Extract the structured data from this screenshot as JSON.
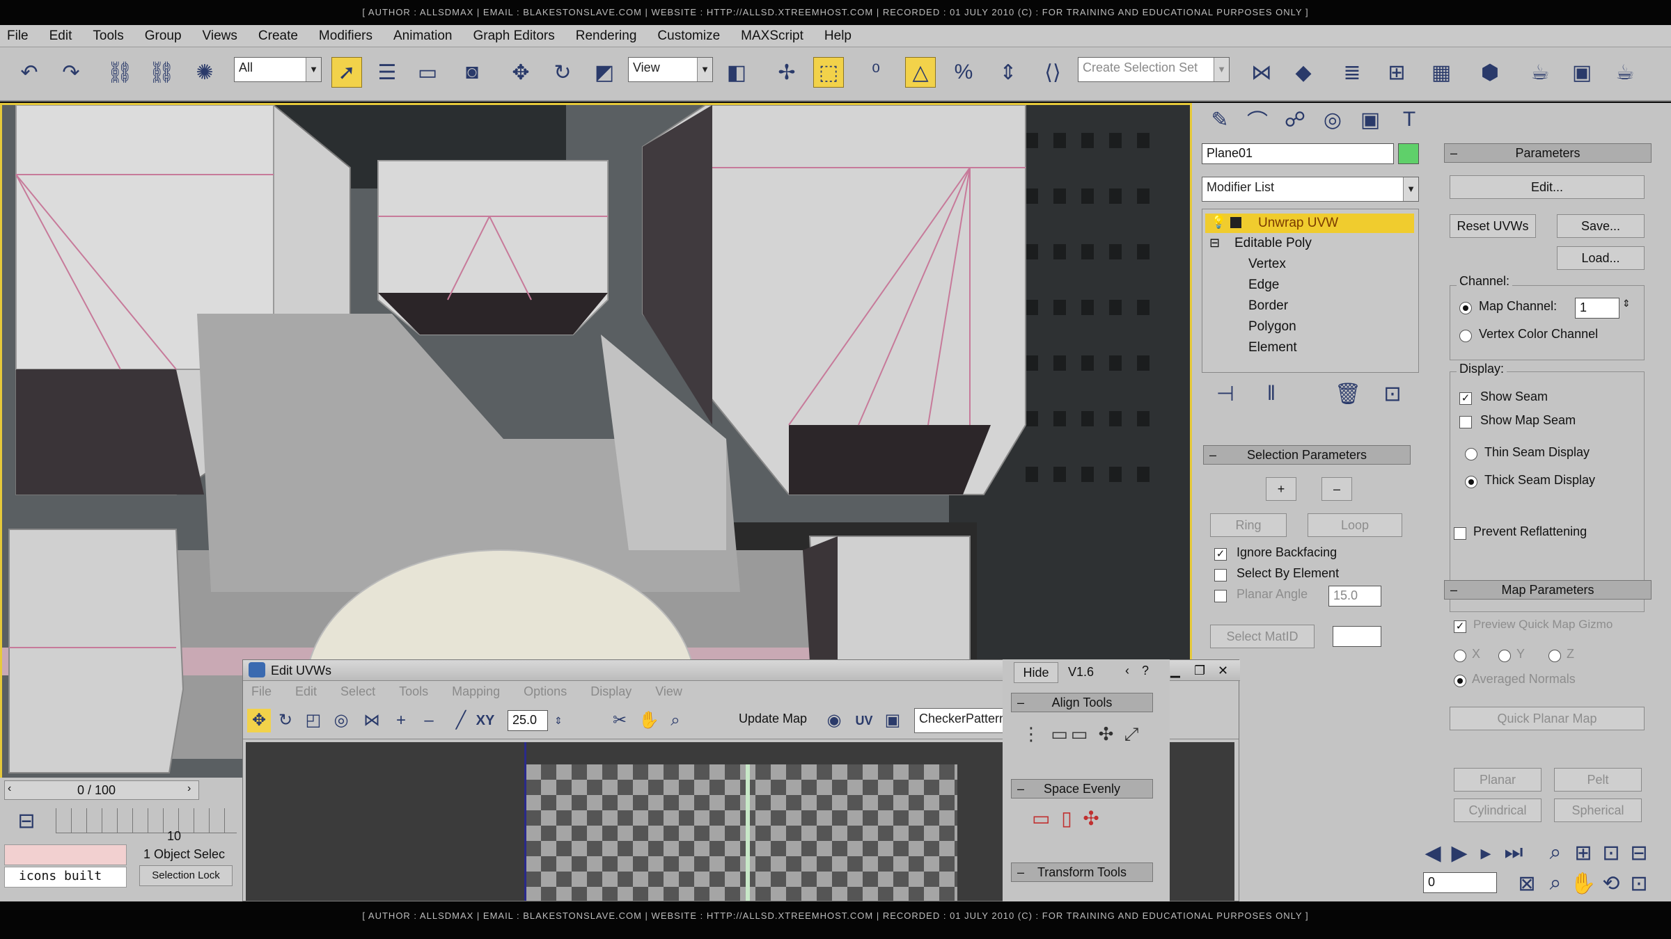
{
  "banner": {
    "text": "[ AUTHOR : ALLSDMAX | EMAIL : BLAKESTONSLAVE.COM | WEBSITE : HTTP://ALLSD.XTREEMHOST.COM | RECORDED : 01 JULY 2010 (C) : FOR TRAINING AND EDUCATIONAL PURPOSES ONLY ]"
  },
  "menu": [
    "File",
    "Edit",
    "Tools",
    "Group",
    "Views",
    "Create",
    "Modifiers",
    "Animation",
    "Graph Editors",
    "Rendering",
    "Customize",
    "MAXScript",
    "Help"
  ],
  "toolbar": {
    "filter_value": "All",
    "refcoord_value": "View",
    "selset_placeholder": "Create Selection Set"
  },
  "panel": {
    "object_name": "Plane01",
    "object_color": "#5fd06a",
    "modifier_list": "Modifier List",
    "stack": [
      {
        "label": "Unwrap UVW",
        "level": 0,
        "selected": true
      },
      {
        "label": "Editable Poly",
        "level": 0,
        "selected": false
      },
      {
        "label": "Vertex",
        "level": 1
      },
      {
        "label": "Edge",
        "level": 1
      },
      {
        "label": "Border",
        "level": 1
      },
      {
        "label": "Polygon",
        "level": 1
      },
      {
        "label": "Element",
        "level": 1
      }
    ],
    "selection_params": {
      "header": "Selection Parameters",
      "ring": "Ring",
      "loop": "Loop",
      "ignore_backfacing": "Ignore Backfacing",
      "select_by_element": "Select By Element",
      "planar_angle": "Planar Angle",
      "planar_value": "15.0",
      "select_matid": "Select MatID",
      "matid_value": ""
    },
    "parameters": {
      "header": "Parameters",
      "edit": "Edit...",
      "reset": "Reset UVWs",
      "save": "Save...",
      "load": "Load...",
      "channel_label": "Channel:",
      "map_channel": "Map Channel:",
      "map_channel_value": "1",
      "vertex_color_channel": "Vertex Color Channel",
      "display_label": "Display:",
      "show_seam": "Show Seam",
      "show_map_seam": "Show Map Seam",
      "thin_seam": "Thin Seam Display",
      "thick_seam": "Thick Seam Display",
      "prevent_reflattening": "Prevent Reflattening"
    },
    "map_params": {
      "header": "Map Parameters",
      "preview_quick_map": "Preview Quick Map Gizmo",
      "x": "X",
      "y": "Y",
      "z": "Z",
      "averaged_normals": "Averaged Normals",
      "quick_planar": "Quick Planar Map",
      "planar": "Planar",
      "pelt": "Pelt",
      "cylindrical": "Cylindrical",
      "spherical": "Spherical"
    }
  },
  "uvw": {
    "title": "Edit UVWs",
    "menu": [
      "File",
      "Edit",
      "Select",
      "Tools",
      "Mapping",
      "Options",
      "Display",
      "View"
    ],
    "xy": "XY",
    "spin_value": "25.0",
    "update_map": "Update Map",
    "uv": "UV",
    "texture": "CheckerPattern  ( Checker )",
    "side": {
      "hide": "Hide",
      "version": "V1.6",
      "align": "Align Tools",
      "space": "Space Evenly",
      "transform": "Transform Tools"
    }
  },
  "time": {
    "frame": "0 / 100",
    "tick": "10",
    "status": "1 Object Selec",
    "prompt": "icons built",
    "sel_lock": "Selection Lock"
  },
  "nav": {
    "spin_value": "0"
  }
}
